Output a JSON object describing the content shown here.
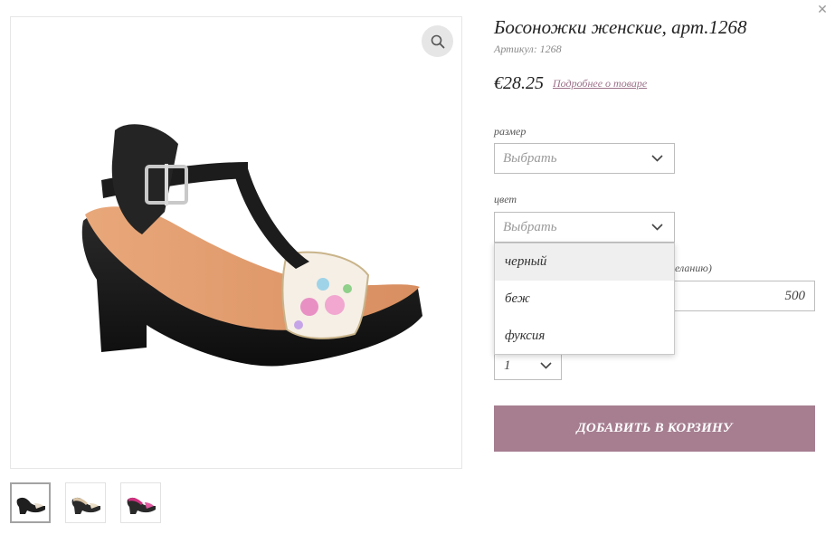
{
  "close_icon": "close-icon",
  "product": {
    "title": "Босоножки женские, арт.1268",
    "sku": "Артикул: 1268",
    "price": "€28.25",
    "details_link": "Подробнее о товаре"
  },
  "size": {
    "label": "размер",
    "placeholder": "Выбрать"
  },
  "color": {
    "label": "цвет",
    "placeholder": "Выбрать",
    "options": [
      "черный",
      "беж",
      "фуксия"
    ],
    "highlighted_option": "черный"
  },
  "amount": {
    "label_partial": "желанию)",
    "value": "500"
  },
  "quantity": {
    "value": "1"
  },
  "add_to_cart": "ДОБАВИТЬ В КОРЗИНУ",
  "thumbnails": [
    {
      "name": "black",
      "accent": "#1f1f1f"
    },
    {
      "name": "beige",
      "accent": "#d8c3a5"
    },
    {
      "name": "fuchsia",
      "accent": "#d0307f"
    }
  ],
  "colors": {
    "accent": "#a67e90",
    "link": "#9c7189",
    "border": "#bdbdbd"
  }
}
